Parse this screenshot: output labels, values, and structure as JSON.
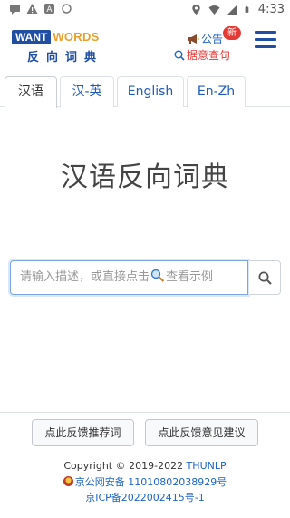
{
  "status_bar": {
    "time": "4:33"
  },
  "header": {
    "logo_want": "WANT",
    "logo_words": "WORDS",
    "logo_cn": "反向词典",
    "notice_label": "公告",
    "new_badge": "新",
    "sentence_label": "据意查句"
  },
  "tabs": [
    {
      "label": "汉语",
      "active": true
    },
    {
      "label": "汉-英",
      "active": false
    },
    {
      "label": "English",
      "active": false
    },
    {
      "label": "En-Zh",
      "active": false
    }
  ],
  "main": {
    "title": "汉语反向词典"
  },
  "search": {
    "placeholder_text": "请输入描述，或直接点击",
    "placeholder_suffix": "查看示例"
  },
  "footer": {
    "feedback_recommend": "点此反馈推荐词",
    "feedback_suggest": "点此反馈意见建议",
    "copyright_prefix": "Copyright © 2019-2022 ",
    "copyright_org": "THUNLP",
    "police_record": "京公网安备 11010802038929号",
    "icp_record": "京ICP备2022002415号-1"
  },
  "colors": {
    "brand_blue": "#1f4ea3",
    "brand_orange": "#e8a02c",
    "link_blue": "#2066c4",
    "badge_red": "#e53935"
  }
}
